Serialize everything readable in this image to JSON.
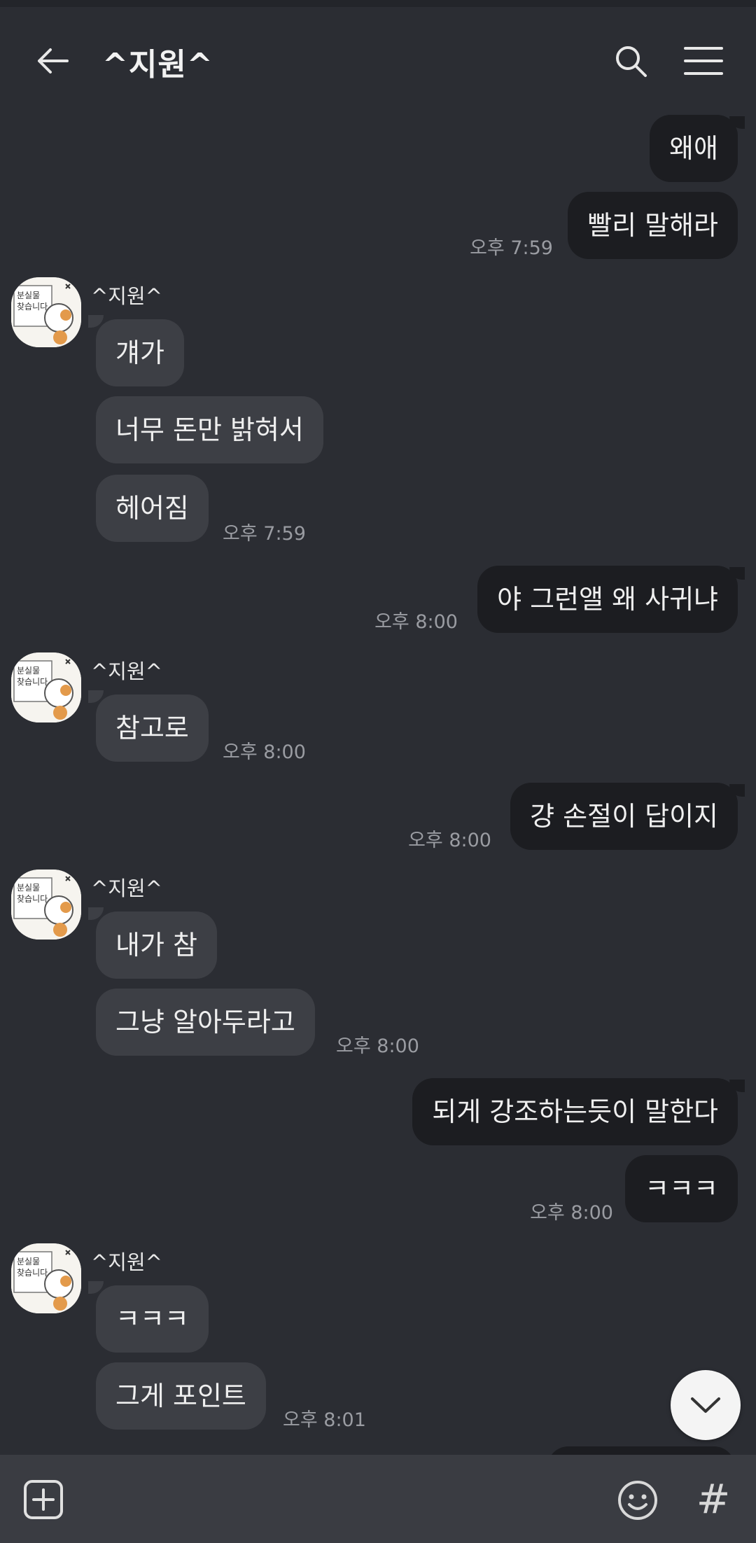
{
  "header": {
    "title": "^지원^",
    "back_icon": "arrow-left-icon",
    "search_icon": "search-icon",
    "menu_icon": "hamburger-menu-icon"
  },
  "messages": [
    {
      "type": "out",
      "text": "왜애"
    },
    {
      "type": "out",
      "text": "빨리 말해라",
      "time": "오후 7:59"
    },
    {
      "type": "sender",
      "name": "^지원^"
    },
    {
      "type": "in",
      "text": "걔가"
    },
    {
      "type": "in",
      "text": "너무 돈만 밝혀서"
    },
    {
      "type": "in",
      "text": "헤어짐",
      "time": "오후 7:59"
    },
    {
      "type": "out",
      "text": "야 그런앨 왜 사귀냐",
      "time": "오후 8:00"
    },
    {
      "type": "sender",
      "name": "^지원^"
    },
    {
      "type": "in",
      "text": "참고로",
      "time": "오후 8:00"
    },
    {
      "type": "out",
      "text": "걍 손절이 답이지",
      "time": "오후 8:00"
    },
    {
      "type": "sender",
      "name": "^지원^"
    },
    {
      "type": "in",
      "text": "내가 참"
    },
    {
      "type": "in",
      "text": "그냥 알아두라고",
      "time": "오후 8:00"
    },
    {
      "type": "out",
      "text": "되게 강조하는듯이 말한다"
    },
    {
      "type": "out",
      "text": "ㅋㅋㅋ",
      "time": "오후 8:00"
    },
    {
      "type": "sender",
      "name": "^지원^"
    },
    {
      "type": "in",
      "text": "ㅋㅋㅋ"
    },
    {
      "type": "in",
      "text": "그게 포인트",
      "time": "오후 8:01"
    }
  ],
  "avatar": {
    "image_text_lines": [
      "분실물",
      "찾습니다"
    ]
  },
  "controls": {
    "scroll_down_icon": "chevron-down-icon",
    "add_icon": "plus-square-icon",
    "emoji_icon": "smiley-icon",
    "hashtag": "#"
  },
  "colors": {
    "background": "#2b2d33",
    "outgoing_bubble": "#1c1d21",
    "incoming_bubble": "#3d3f45",
    "input_bar": "#3a3c42",
    "time_text": "#9a9ca2"
  }
}
